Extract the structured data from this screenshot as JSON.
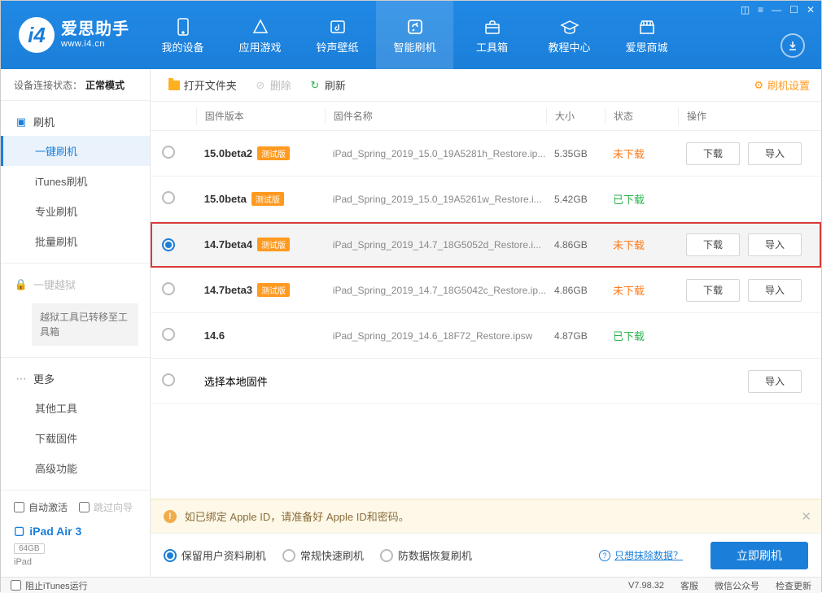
{
  "brand": {
    "name": "爱思助手",
    "url": "www.i4.cn",
    "logo_letter": "i4"
  },
  "nav": [
    {
      "label": "我的设备"
    },
    {
      "label": "应用游戏"
    },
    {
      "label": "铃声壁纸"
    },
    {
      "label": "智能刷机"
    },
    {
      "label": "工具箱"
    },
    {
      "label": "教程中心"
    },
    {
      "label": "爱思商城"
    }
  ],
  "conn": {
    "label": "设备连接状态：",
    "value": "正常模式"
  },
  "side": {
    "flash": {
      "title": "刷机",
      "items": [
        "一键刷机",
        "iTunes刷机",
        "专业刷机",
        "批量刷机"
      ]
    },
    "jailbreak": {
      "title": "一键越狱",
      "note": "越狱工具已转移至工具箱"
    },
    "more": {
      "title": "更多",
      "items": [
        "其他工具",
        "下载固件",
        "高级功能"
      ]
    }
  },
  "bottom": {
    "auto_activate": "自动激活",
    "skip_guide": "跳过向导",
    "device_name": "iPad Air 3",
    "capacity": "64GB",
    "device_type": "iPad"
  },
  "toolbar": {
    "open_folder": "打开文件夹",
    "delete": "删除",
    "refresh": "刷新",
    "settings": "刷机设置"
  },
  "thead": {
    "version": "固件版本",
    "name": "固件名称",
    "size": "大小",
    "status": "状态",
    "ops": "操作"
  },
  "beta_tag": "测试版",
  "rows": [
    {
      "version": "15.0beta2",
      "beta": true,
      "name": "iPad_Spring_2019_15.0_19A5281h_Restore.ip...",
      "size": "5.35GB",
      "status": "未下载",
      "status_class": "st-not",
      "download": true,
      "import": true,
      "selected": false
    },
    {
      "version": "15.0beta",
      "beta": true,
      "name": "iPad_Spring_2019_15.0_19A5261w_Restore.i...",
      "size": "5.42GB",
      "status": "已下载",
      "status_class": "st-done",
      "download": false,
      "import": false,
      "selected": false
    },
    {
      "version": "14.7beta4",
      "beta": true,
      "name": "iPad_Spring_2019_14.7_18G5052d_Restore.i...",
      "size": "4.86GB",
      "status": "未下载",
      "status_class": "st-not",
      "download": true,
      "import": true,
      "selected": true
    },
    {
      "version": "14.7beta3",
      "beta": true,
      "name": "iPad_Spring_2019_14.7_18G5042c_Restore.ip...",
      "size": "4.86GB",
      "status": "未下载",
      "status_class": "st-not",
      "download": true,
      "import": true,
      "selected": false
    },
    {
      "version": "14.6",
      "beta": false,
      "name": "iPad_Spring_2019_14.6_18F72_Restore.ipsw",
      "size": "4.87GB",
      "status": "已下载",
      "status_class": "st-done",
      "download": false,
      "import": false,
      "selected": false
    }
  ],
  "local_row": {
    "label": "选择本地固件",
    "import_label": "导入"
  },
  "op_labels": {
    "download": "下载",
    "import": "导入"
  },
  "notice": "如已绑定 Apple ID，请准备好 Apple ID和密码。",
  "opts": [
    "保留用户资料刷机",
    "常规快速刷机",
    "防数据恢复刷机"
  ],
  "erase_link": "只想抹除数据？",
  "flash_btn": "立即刷机",
  "footer": {
    "block_itunes": "阻止iTunes运行",
    "version": "V7.98.32",
    "service": "客服",
    "wechat": "微信公众号",
    "update": "检查更新"
  }
}
